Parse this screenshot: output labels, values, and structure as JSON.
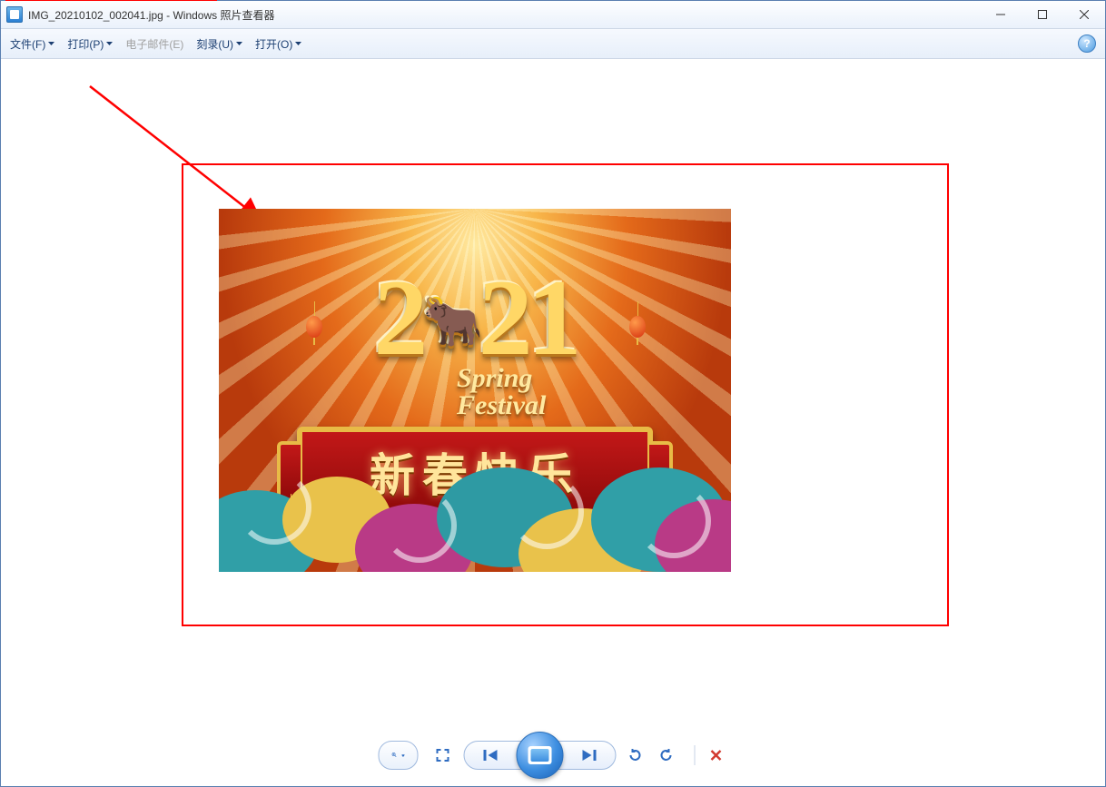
{
  "titlebar": {
    "filename": "IMG_20210102_002041.jpg",
    "app_suffix": " - Windows 照片查看器"
  },
  "menu": {
    "file": "文件(F)",
    "print": "打印(P)",
    "email": "电子邮件(E)",
    "burn": "刻录(U)",
    "open": "打开(O)"
  },
  "image": {
    "year": "2021",
    "ox_emoji": "🐂",
    "subtitle_line1": "Spring",
    "subtitle_line2": "Festival",
    "banner_text": "新春快乐"
  },
  "toolbar": {
    "zoom_tip": "更改显示大小",
    "fit_tip": "实际大小",
    "prev_tip": "上一个",
    "play_tip": "播放幻灯片",
    "next_tip": "下一个",
    "rotl_tip": "逆时针旋转",
    "rotr_tip": "顺时针旋转",
    "del_tip": "删除"
  },
  "help_symbol": "?"
}
